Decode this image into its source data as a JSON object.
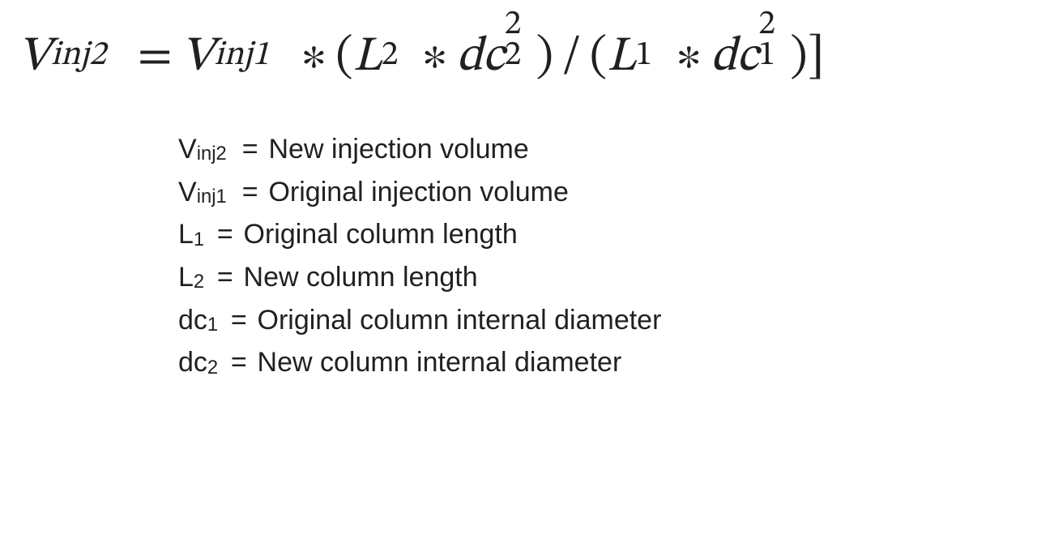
{
  "formula": {
    "v": "V",
    "inj2": "inj2",
    "inj1": "inj1",
    "eq": "=",
    "mul": "∗",
    "div": "/",
    "lpar": "(",
    "rpar": ")",
    "rbrk": "]",
    "L": "L",
    "dc": "dc",
    "n1": "1",
    "n2": "2",
    "sq": "2"
  },
  "legend": {
    "sym_V": "V",
    "sym_L": "L",
    "sym_dc": "dc",
    "sub_inj2": "inj2",
    "sub_inj1": "inj1",
    "sub_1": "1",
    "sub_2": "2",
    "eq": "=",
    "d0": "New injection volume",
    "d1": "Original injection volume",
    "d2": "Original column length",
    "d3": "New column length",
    "d4": "Original column internal diameter",
    "d5": "New column internal diameter"
  }
}
